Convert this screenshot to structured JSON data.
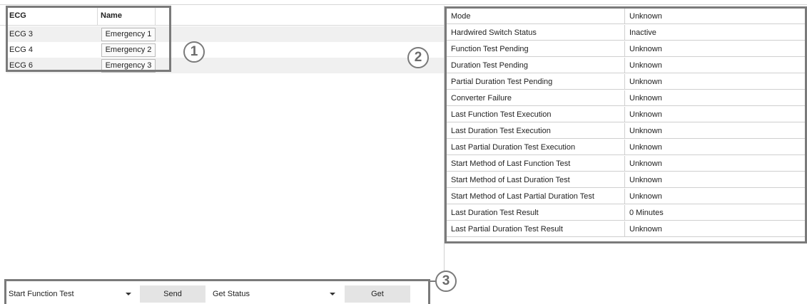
{
  "grid": {
    "headers": {
      "ecg": "ECG",
      "name": "Name"
    },
    "rows": [
      {
        "ecg": "ECG 3",
        "name": "Emergency 1"
      },
      {
        "ecg": "ECG 4",
        "name": "Emergency 2"
      },
      {
        "ecg": "ECG 6",
        "name": "Emergency 3"
      }
    ]
  },
  "annotations": {
    "one": "①",
    "two": "②",
    "three": "3"
  },
  "status": [
    {
      "label": "Mode",
      "value": "Unknown"
    },
    {
      "label": "Hardwired Switch Status",
      "value": "Inactive"
    },
    {
      "label": "Function Test Pending",
      "value": "Unknown"
    },
    {
      "label": "Duration Test Pending",
      "value": "Unknown"
    },
    {
      "label": "Partial Duration Test Pending",
      "value": "Unknown"
    },
    {
      "label": "Converter Failure",
      "value": "Unknown"
    },
    {
      "label": "Last Function Test Execution",
      "value": "Unknown"
    },
    {
      "label": "Last Duration Test Execution",
      "value": "Unknown"
    },
    {
      "label": "Last Partial Duration Test Execution",
      "value": "Unknown"
    },
    {
      "label": "Start Method of Last Function Test",
      "value": "Unknown"
    },
    {
      "label": "Start Method of Last Duration Test",
      "value": "Unknown"
    },
    {
      "label": "Start Method of Last Partial Duration Test",
      "value": "Unknown"
    },
    {
      "label": "Last Duration Test Result",
      "value": "0 Minutes"
    },
    {
      "label": "Last Partial Duration Test Result",
      "value": "Unknown"
    }
  ],
  "toolbar": {
    "command_select": "Start Function Test",
    "send_label": "Send",
    "query_select": "Get Status",
    "get_label": "Get"
  }
}
